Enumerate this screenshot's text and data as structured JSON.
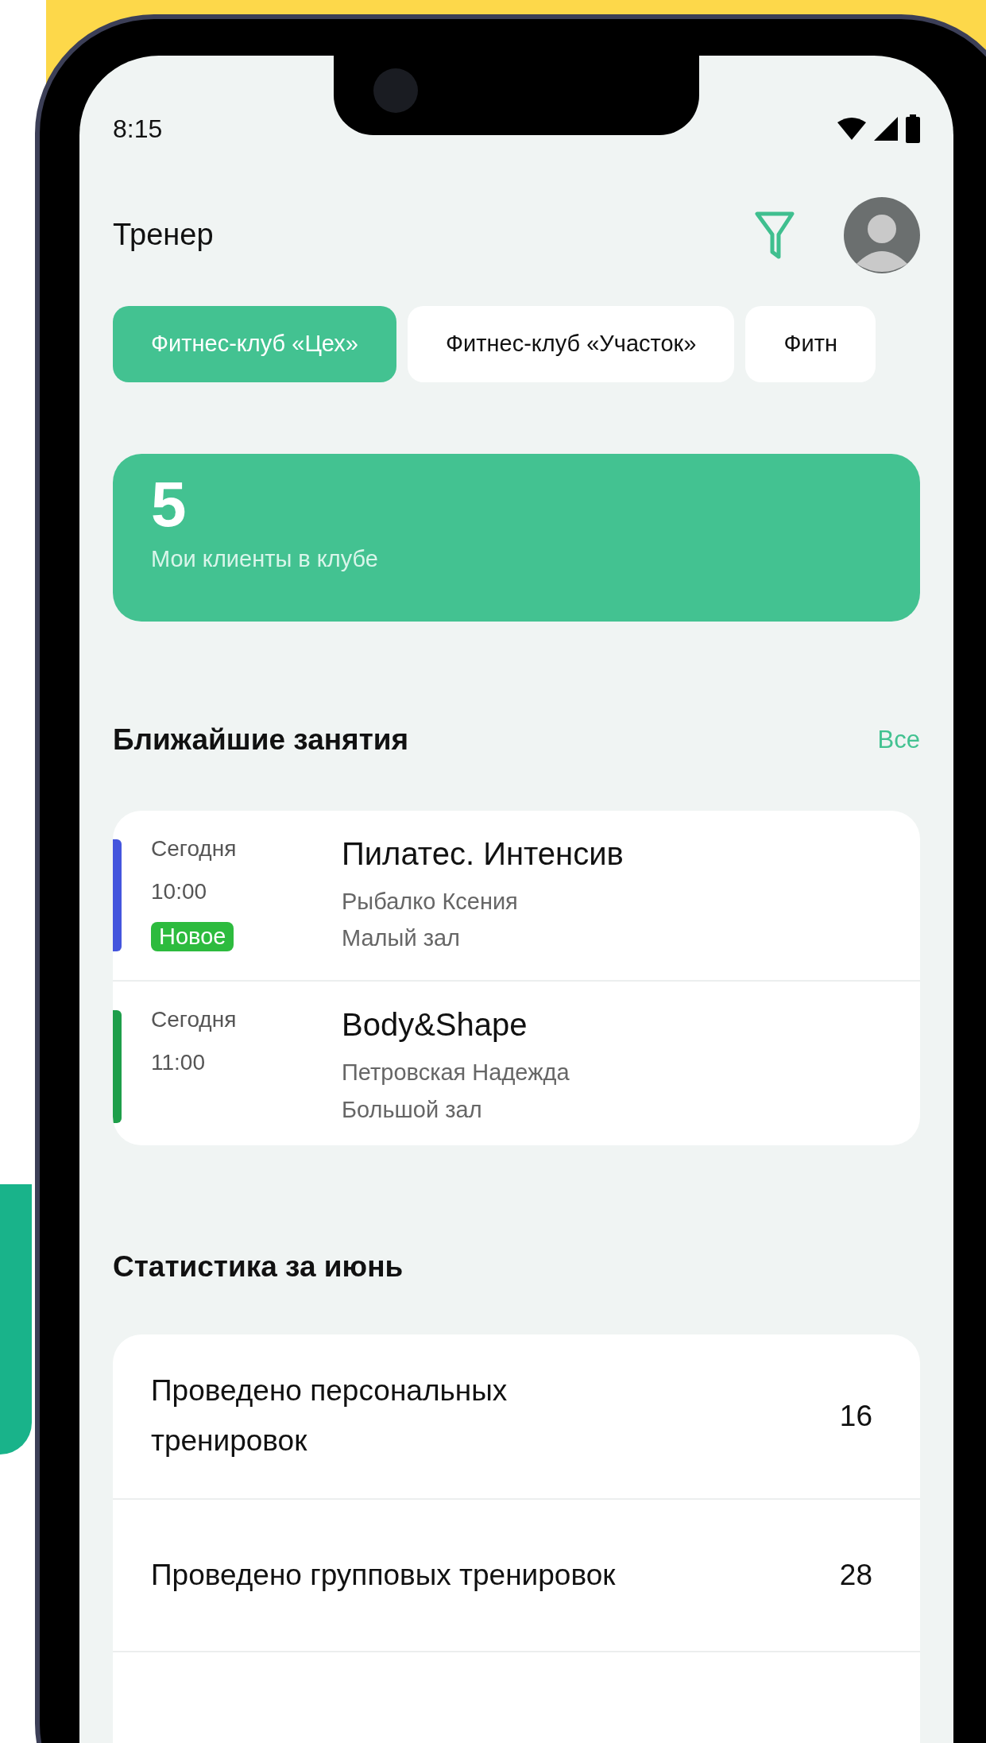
{
  "status_bar": {
    "time": "8:15"
  },
  "header": {
    "title": "Тренер"
  },
  "clubs": [
    {
      "label": "Фитнес-клуб «Цех»",
      "selected": true
    },
    {
      "label": "Фитнес-клуб «Участок»",
      "selected": false
    },
    {
      "label": "Фитн",
      "selected": false
    }
  ],
  "clients_card": {
    "count": "5",
    "label": "Мои клиенты в клубе"
  },
  "upcoming": {
    "title": "Ближайшие занятия",
    "link": "Все",
    "lessons": [
      {
        "day": "Сегодня",
        "time": "10:00",
        "title": "Пилатес. Интенсив",
        "trainer": "Рыбалко Ксения",
        "room": "Малый зал",
        "color": "#4455dd",
        "badge": "Новое"
      },
      {
        "day": "Сегодня",
        "time": "11:00",
        "title": "Body&Shape",
        "trainer": "Петровская Надежда",
        "room": "Большой зал",
        "color": "#1e9e4a"
      }
    ]
  },
  "stats": {
    "title": "Статистика за июнь",
    "rows": [
      {
        "label": "Проведено персональных тренировок",
        "value": "16"
      },
      {
        "label": "Проведено групповых тренировок",
        "value": "28"
      }
    ]
  }
}
